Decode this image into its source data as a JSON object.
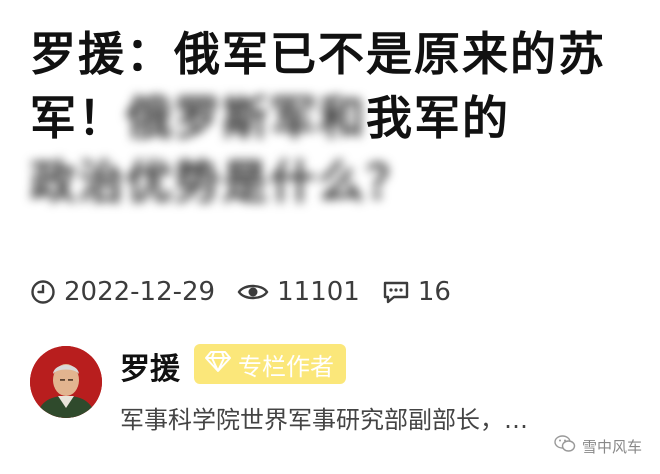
{
  "article": {
    "title_visible": "罗援：俄军已不是原来的苏军！",
    "title_blurred_1": "俄罗斯军和",
    "title_visible_2": "我军的",
    "title_blurred_2": "政治优势是什么？",
    "date": "2022-12-29",
    "views": "11101",
    "comments": "16"
  },
  "author": {
    "name": "罗援",
    "badge": "专栏作者",
    "bio": "军事科学院世界军事研究部副部长，…"
  },
  "watermark": {
    "text": "雪中风车"
  },
  "icons": {
    "date": "clock-icon",
    "views": "eye-icon",
    "comments": "chat-bubble-icon",
    "badge": "diamond-icon",
    "watermark": "wechat-icon"
  },
  "colors": {
    "badge_bg": "#fbe77a",
    "avatar_bg": "#b81e1e"
  }
}
